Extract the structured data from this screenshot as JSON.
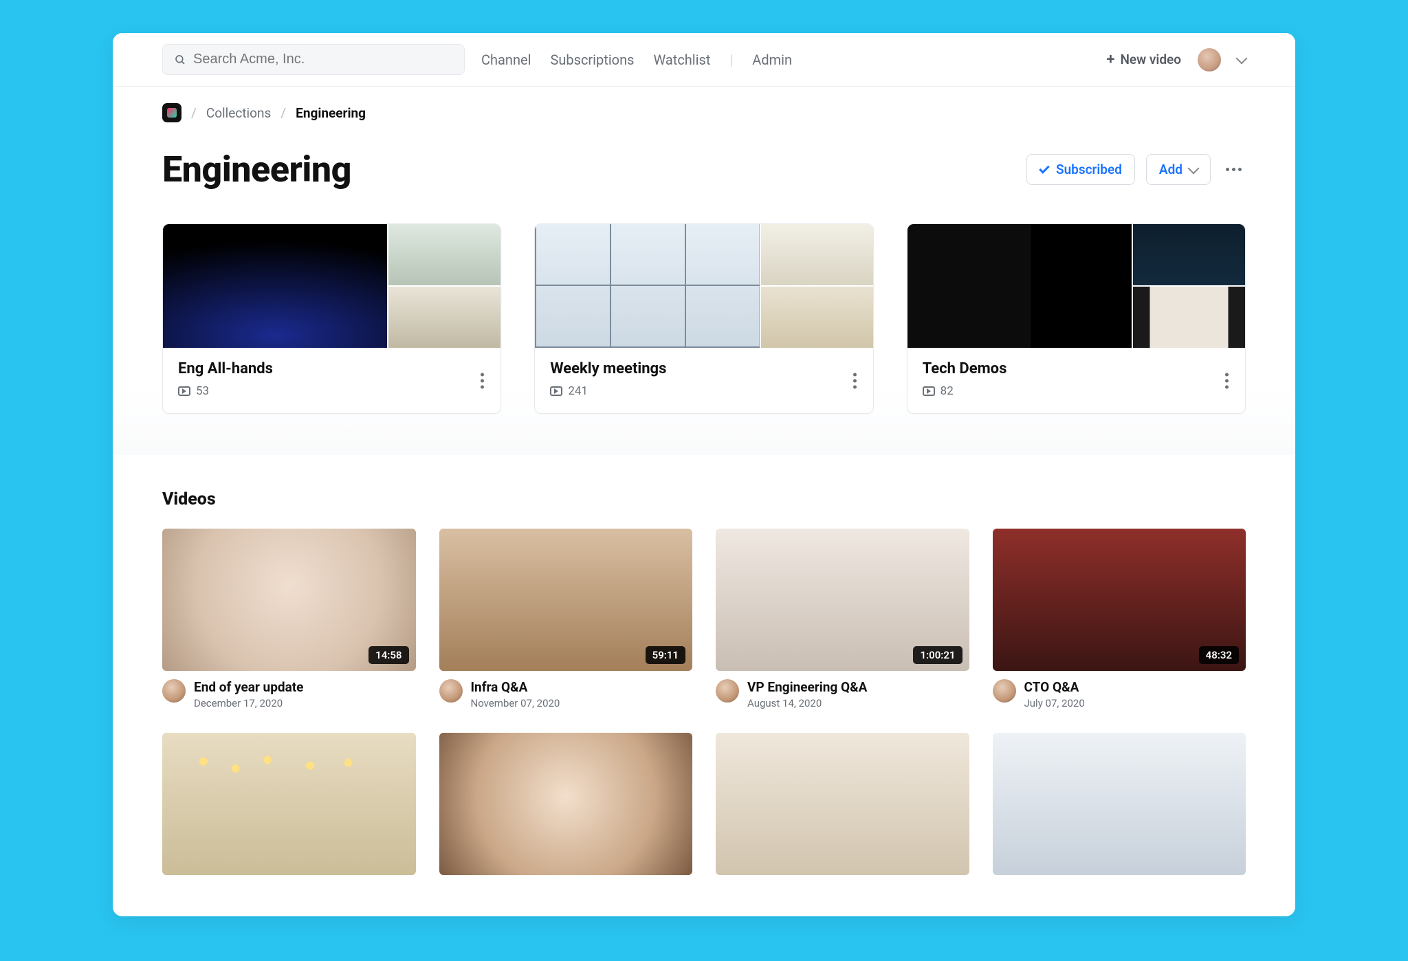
{
  "header": {
    "search_placeholder": "Search Acme, Inc.",
    "nav": {
      "channel": "Channel",
      "subscriptions": "Subscriptions",
      "watchlist": "Watchlist",
      "admin": "Admin"
    },
    "new_video_label": "New video"
  },
  "breadcrumb": {
    "collections": "Collections",
    "current": "Engineering"
  },
  "page": {
    "title": "Engineering",
    "subscribed_label": "Subscribed",
    "add_label": "Add"
  },
  "collections": [
    {
      "title": "Eng All-hands",
      "count": "53"
    },
    {
      "title": "Weekly meetings",
      "count": "241"
    },
    {
      "title": "Tech Demos",
      "count": "82"
    }
  ],
  "videos_section_title": "Videos",
  "videos": [
    {
      "title": "End of year update",
      "date": "December 17, 2020",
      "duration": "14:58"
    },
    {
      "title": "Infra Q&A",
      "date": "November 07, 2020",
      "duration": "59:11"
    },
    {
      "title": "VP Engineering Q&A",
      "date": "August 14, 2020",
      "duration": "1:00:21"
    },
    {
      "title": "CTO Q&A",
      "date": "July 07, 2020",
      "duration": "48:32"
    }
  ]
}
